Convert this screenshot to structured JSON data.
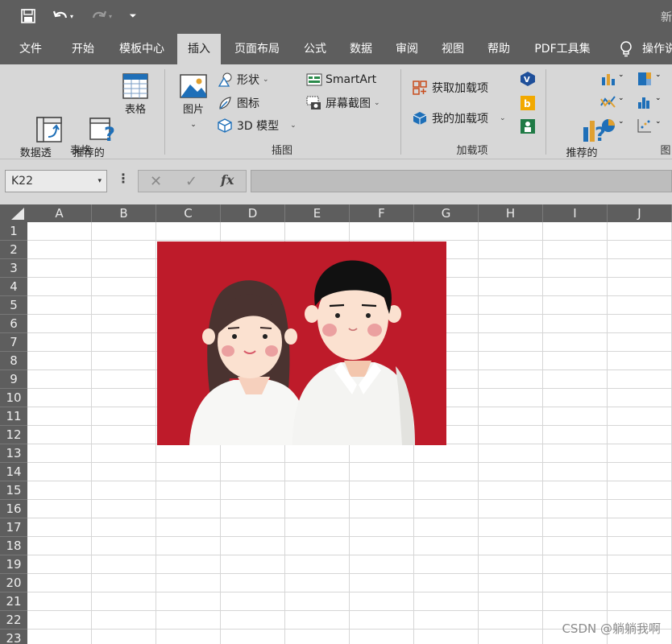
{
  "titlebar": {
    "title_fragment": "新",
    "quick_access": {
      "save_icon": "save-icon",
      "undo_icon": "undo-icon",
      "redo_icon": "redo-icon",
      "customize_icon": "customize-icon"
    }
  },
  "tabs": [
    "文件",
    "开始",
    "模板中心",
    "插入",
    "页面布局",
    "公式",
    "数据",
    "审阅",
    "视图",
    "帮助",
    "PDF工具集"
  ],
  "active_tab": "插入",
  "search_label": "操作说",
  "ribbon": {
    "tables": {
      "pivot": "数据透\n视表",
      "recommended_pivot": "推荐的\n数据透视表",
      "table": "表格",
      "group_label": "表格"
    },
    "illustrations": {
      "pictures": "图片",
      "shapes": "形状",
      "icons": "图标",
      "models": "3D 模型",
      "smartart": "SmartArt",
      "screenshot": "屏幕截图",
      "group_label": "插图"
    },
    "addins": {
      "get": "获取加载项",
      "mine": "我的加载项",
      "group_label": "加载项"
    },
    "charts": {
      "recommended": "推荐的\n图表",
      "group_label": "图"
    }
  },
  "formula_bar": {
    "name_box": "K22",
    "cancel": "✕",
    "enter": "✓",
    "fx": "fx",
    "formula": ""
  },
  "columns": [
    "A",
    "B",
    "C",
    "D",
    "E",
    "F",
    "G",
    "H",
    "I",
    "J"
  ],
  "rows": [
    "1",
    "2",
    "3",
    "4",
    "5",
    "6",
    "7",
    "8",
    "9",
    "10",
    "11",
    "12",
    "13",
    "14",
    "15",
    "16",
    "17",
    "18",
    "19",
    "20",
    "21",
    "22",
    "23"
  ],
  "picture": {
    "description_icon": "couple-portrait-image",
    "background_color": "#be1b2a"
  },
  "watermark": "CSDN @躺躺我啊"
}
